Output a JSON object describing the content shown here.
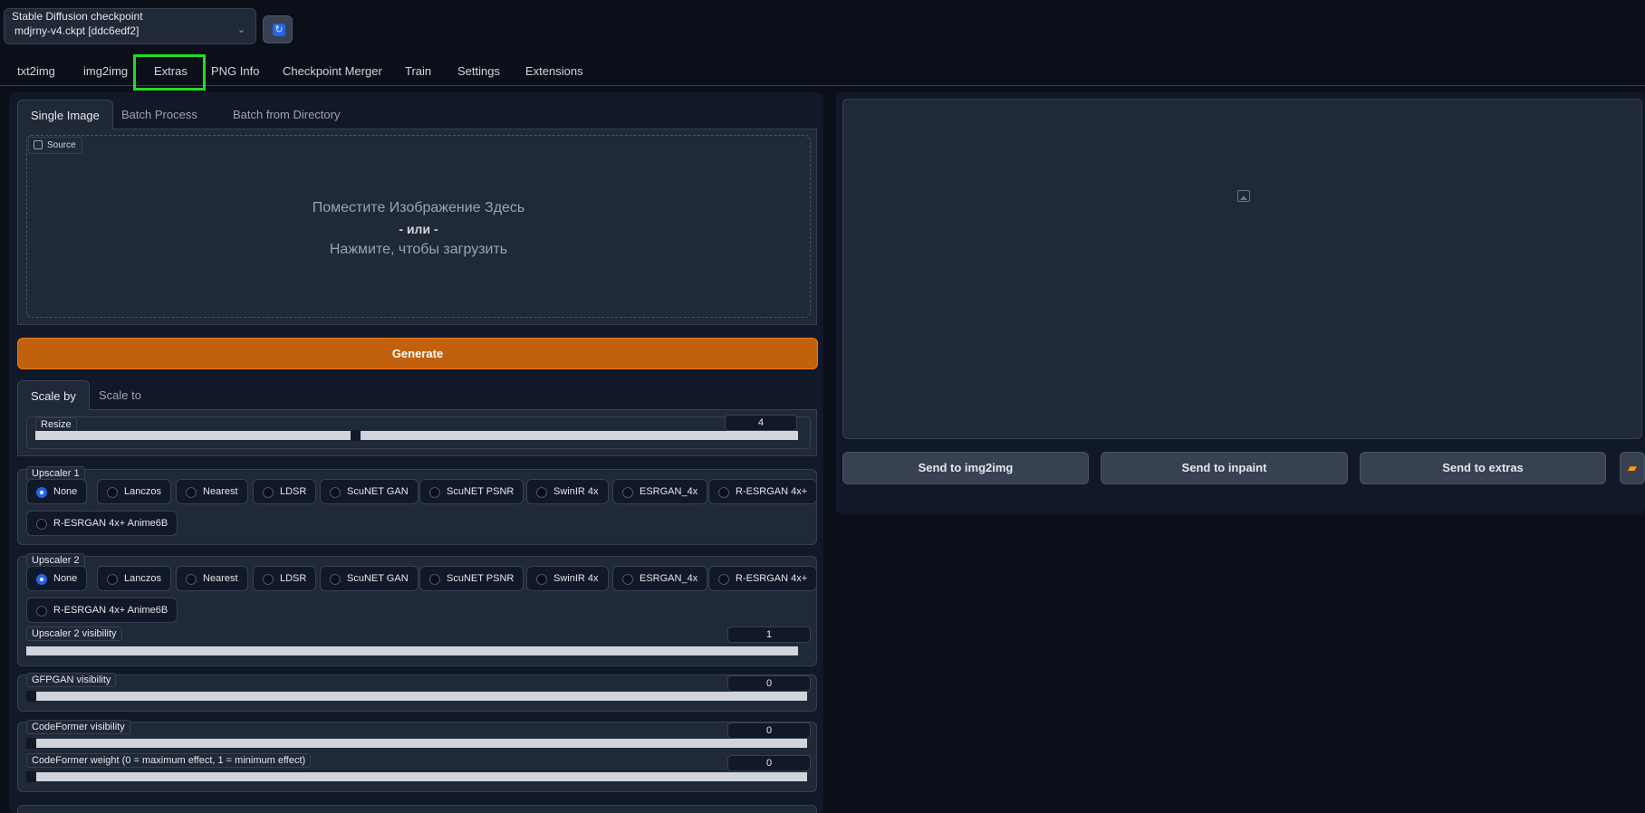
{
  "checkpoint": {
    "label": "Stable Diffusion checkpoint",
    "value": "mdjrny-v4.ckpt [ddc6edf2]",
    "chevron": "chevron-down-icon",
    "refresh_icon": "refresh-icon"
  },
  "tabs": [
    "txt2img",
    "img2img",
    "Extras",
    "PNG Info",
    "Checkpoint Merger",
    "Train",
    "Settings",
    "Extensions"
  ],
  "active_tab": "Extras",
  "highlight_color": "#22dd22",
  "extras": {
    "subtabs": [
      "Single Image",
      "Batch Process",
      "Batch from Directory"
    ],
    "source_label": "Source",
    "drop_line1": "Поместите Изображение Здесь",
    "drop_line2": "- или -",
    "drop_line3": "Нажмите, чтобы загрузить",
    "generate_label": "Generate",
    "scale_tabs": [
      "Scale by",
      "Scale to"
    ],
    "resize_label": "Resize",
    "resize_value": "4",
    "upscaler1_label": "Upscaler 1",
    "upscaler2_label": "Upscaler 2",
    "upscalers": [
      "None",
      "Lanczos",
      "Nearest",
      "LDSR",
      "ScuNET GAN",
      "ScuNET PSNR",
      "SwinIR 4x",
      "ESRGAN_4x",
      "R-ESRGAN 4x+",
      "R-ESRGAN 4x+ Anime6B"
    ],
    "upscaler1_selected": "None",
    "upscaler2_selected": "None",
    "upscaler2_visibility_label": "Upscaler 2 visibility",
    "upscaler2_visibility_value": "1",
    "gfpgan_label": "GFPGAN visibility",
    "gfpgan_value": "0",
    "codeformer_vis_label": "CodeFormer visibility",
    "codeformer_vis_value": "0",
    "codeformer_weight_label": "CodeFormer weight (0 = maximum effect, 1 = minimum effect)",
    "codeformer_weight_value": "0"
  },
  "output": {
    "image_icon": "image-icon",
    "send_img2img": "Send to img2img",
    "send_inpaint": "Send to inpaint",
    "send_extras": "Send to extras",
    "folder_icon": "folder-icon"
  },
  "colors": {
    "accent": "#c2610c",
    "radio_selected": "#2563eb",
    "background": "#0b0f19"
  }
}
